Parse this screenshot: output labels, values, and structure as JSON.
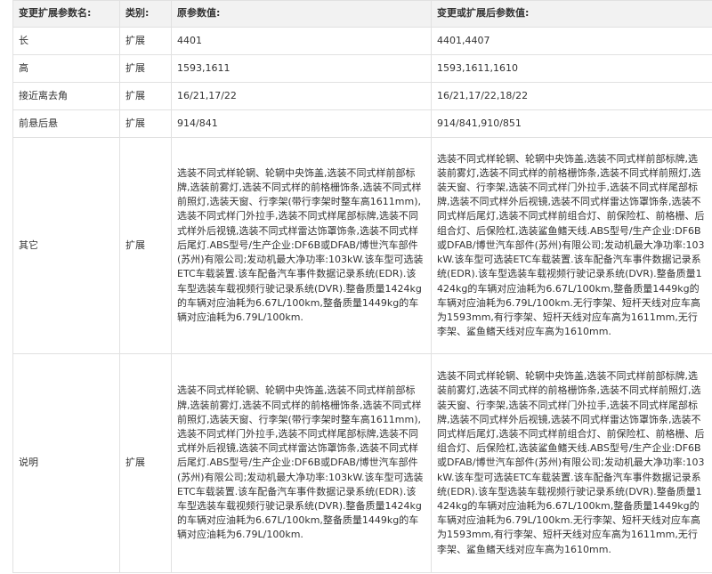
{
  "table": {
    "headers": [
      "变更扩展参数名:",
      "类别:",
      "原参数值:",
      "变更或扩展后参数值:"
    ],
    "rows": [
      {
        "name": "长",
        "type": "扩展",
        "original": "4401",
        "changed": "4401,4407"
      },
      {
        "name": "高",
        "type": "扩展",
        "original": "1593,1611",
        "changed": "1593,1611,1610"
      },
      {
        "name": "接近离去角",
        "type": "扩展",
        "original": "16/21,17/22",
        "changed": "16/21,17/22,18/22"
      },
      {
        "name": "前悬后悬",
        "type": "扩展",
        "original": "914/841",
        "changed": "914/841,910/851"
      },
      {
        "name": "其它",
        "type": "扩展",
        "original": "选装不同式样轮辋、轮辋中央饰盖,选装不同式样前部标牌,选装前雾灯,选装不同式样的前格栅饰条,选装不同式样前照灯,选装天窗、行李架(带行李架时整车高1611mm),选装不同式样门外拉手,选装不同式样尾部标牌,选装不同式样外后视镜,选装不同式样雷达饰罩饰条,选装不同式样后尾灯.ABS型号/生产企业:DF6B或DFAB/博世汽车部件(苏州)有限公司;发动机最大净功率:103kW.该车型可选装ETC车载装置.该车配备汽车事件数据记录系统(EDR).该车型选装车载视频行驶记录系统(DVR).整备质量1424kg的车辆对应油耗为6.67L/100km,整备质量1449kg的车辆对应油耗为6.79L/100km.",
        "changed": "选装不同式样轮辋、轮辋中央饰盖,选装不同式样前部标牌,选装前雾灯,选装不同式样的前格栅饰条,选装不同式样前照灯,选装天窗、行李架,选装不同式样门外拉手,选装不同式样尾部标牌,选装不同式样外后视镜,选装不同式样雷达饰罩饰条,选装不同式样后尾灯,选装不同式样前组合灯、前保险杠、前格栅、后组合灯、后保险杠,选装鲨鱼鳍天线.ABS型号/生产企业:DF6B或DFAB/博世汽车部件(苏州)有限公司;发动机最大净功率:103kW.该车型可选装ETC车载装置.该车配备汽车事件数据记录系统(EDR).该车型选装车载视频行驶记录系统(DVR).整备质量1424kg的车辆对应油耗为6.67L/100km,整备质量1449kg的车辆对应油耗为6.79L/100km.无行李架、短杆天线对应车高为1593mm,有行李架、短杆天线对应车高为1611mm,无行李架、鲨鱼鳍天线对应车高为1610mm."
      },
      {
        "name": "说明",
        "type": "扩展",
        "original": "选装不同式样轮辋、轮辋中央饰盖,选装不同式样前部标牌,选装前雾灯,选装不同式样的前格栅饰条,选装不同式样前照灯,选装天窗、行李架(带行李架时整车高1611mm),选装不同式样门外拉手,选装不同式样尾部标牌,选装不同式样外后视镜,选装不同式样雷达饰罩饰条,选装不同式样后尾灯.ABS型号/生产企业:DF6B或DFAB/博世汽车部件(苏州)有限公司;发动机最大净功率:103kW.该车型可选装ETC车载装置.该车配备汽车事件数据记录系统(EDR).该车型选装车载视频行驶记录系统(DVR).整备质量1424kg的车辆对应油耗为6.67L/100km,整备质量1449kg的车辆对应油耗为6.79L/100km.",
        "changed": "选装不同式样轮辋、轮辋中央饰盖,选装不同式样前部标牌,选装前雾灯,选装不同式样的前格栅饰条,选装不同式样前照灯,选装天窗、行李架,选装不同式样门外拉手,选装不同式样尾部标牌,选装不同式样外后视镜,选装不同式样雷达饰罩饰条,选装不同式样后尾灯,选装不同式样前组合灯、前保险杠、前格栅、后组合灯、后保险杠,选装鲨鱼鳍天线.ABS型号/生产企业:DF6B或DFAB/博世汽车部件(苏州)有限公司;发动机最大净功率:103kW.该车型可选装ETC车载装置.该车配备汽车事件数据记录系统(EDR).该车型选装车载视频行驶记录系统(DVR).整备质量1424kg的车辆对应油耗为6.67L/100km,整备质量1449kg的车辆对应油耗为6.79L/100km.无行李架、短杆天线对应车高为1593mm,有行李架、短杆天线对应车高为1611mm,无行李架、鲨鱼鳍天线对应车高为1610mm."
      }
    ]
  }
}
